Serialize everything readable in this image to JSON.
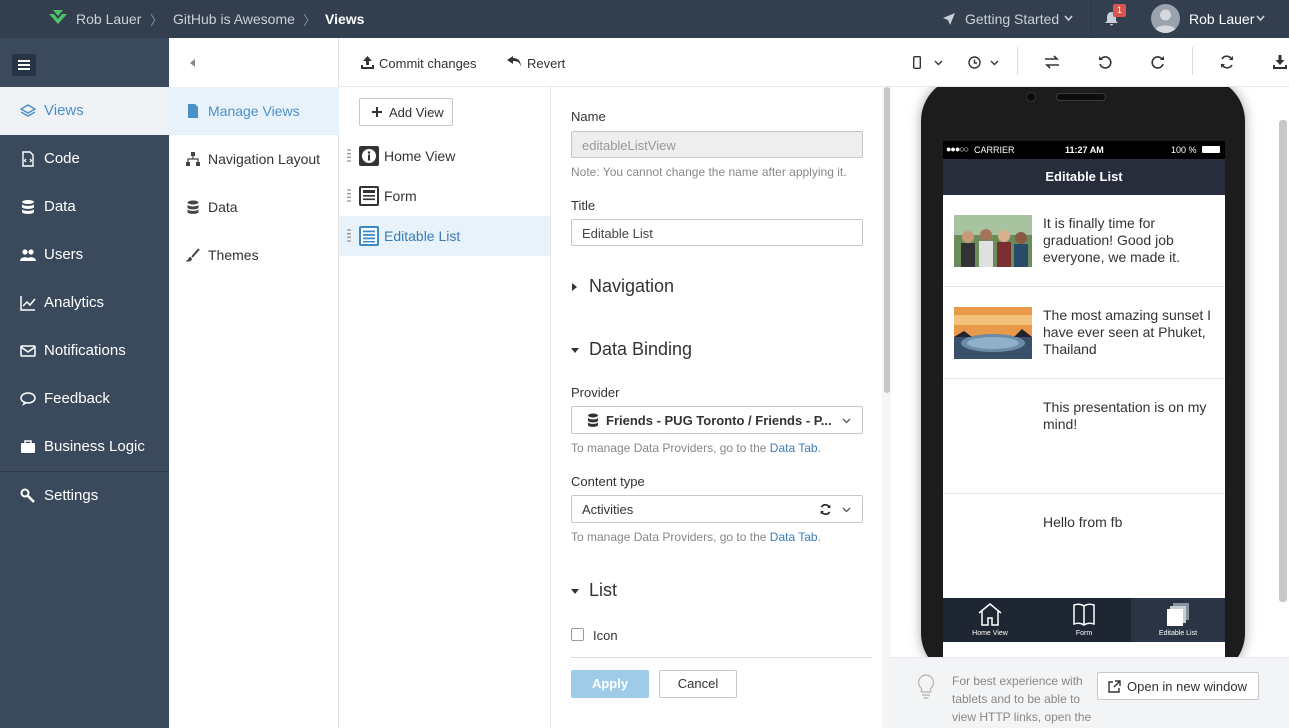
{
  "topbar": {
    "user_short": "Rob Lauer",
    "project": "GitHub is Awesome",
    "current": "Views",
    "getting_started": "Getting Started",
    "notif_count": "1",
    "user": "Rob Lauer",
    "bg": "#333f4f"
  },
  "leftnav": {
    "items": [
      {
        "label": "Views",
        "icon": "layers-icon"
      },
      {
        "label": "Code",
        "icon": "code-file-icon"
      },
      {
        "label": "Data",
        "icon": "database-icon"
      },
      {
        "label": "Users",
        "icon": "users-icon"
      },
      {
        "label": "Analytics",
        "icon": "chart-line-icon"
      },
      {
        "label": "Notifications",
        "icon": "envelope-icon"
      },
      {
        "label": "Feedback",
        "icon": "chat-icon"
      },
      {
        "label": "Business Logic",
        "icon": "briefcase-icon"
      },
      {
        "label": "Settings",
        "icon": "wrench-icon"
      }
    ]
  },
  "subnav": {
    "items": [
      {
        "label": "Manage Views",
        "icon": "file-icon"
      },
      {
        "label": "Navigation Layout",
        "icon": "sitemap-icon"
      },
      {
        "label": "Data",
        "icon": "database-icon"
      },
      {
        "label": "Themes",
        "icon": "brush-icon"
      }
    ]
  },
  "toolbar": {
    "commit": "Commit changes",
    "revert": "Revert"
  },
  "views": {
    "add_label": "Add View",
    "items": [
      {
        "label": "Home View"
      },
      {
        "label": "Form"
      },
      {
        "label": "Editable List"
      }
    ]
  },
  "props": {
    "name_label": "Name",
    "name_value": "editableListView",
    "name_note": "Note: You cannot change the name after applying it.",
    "title_label": "Title",
    "title_value": "Editable List",
    "navigation": "Navigation",
    "data_binding": "Data Binding",
    "provider_label": "Provider",
    "provider_value": "Friends - PUG Toronto / Friends - P...",
    "manage_note": "To manage Data Providers, go to the",
    "data_tab_link": "Data Tab",
    "content_type_label": "Content type",
    "content_type_value": "Activities",
    "list": "List",
    "icon_label": "Icon",
    "apply": "Apply",
    "cancel": "Cancel",
    "apply_color": "#9fcbe8"
  },
  "preview": {
    "carrier": "CARRIER",
    "time": "11:27 AM",
    "battery": "100 %",
    "app_title": "Editable List",
    "feed": [
      {
        "text": "It is finally time for graduation! Good job everyone, we made it."
      },
      {
        "text": "The most amazing sunset I have ever seen at Phuket, Thailand"
      },
      {
        "text": "This presentation is on my mind!"
      },
      {
        "text": "Hello from fb"
      }
    ],
    "tabs": [
      {
        "label": "Home View"
      },
      {
        "label": "Form"
      },
      {
        "label": "Editable List"
      }
    ]
  },
  "tip": {
    "text": "For best experience with tablets and to be able to view HTTP links, open the",
    "open_new": "Open in new window"
  }
}
